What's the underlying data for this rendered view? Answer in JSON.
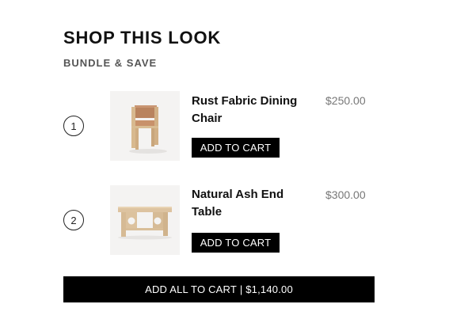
{
  "header": {
    "title": "SHOP THIS LOOK",
    "subtitle": "BUNDLE & SAVE"
  },
  "products": [
    {
      "number": "1",
      "name": "Rust Fabric Dining Chair",
      "price": "$250.00",
      "button_label": "ADD TO CART",
      "image_icon": "dining-chair-icon"
    },
    {
      "number": "2",
      "name": "Natural Ash End Table",
      "price": "$300.00",
      "button_label": "ADD TO CART",
      "image_icon": "end-table-icon"
    }
  ],
  "footer": {
    "add_all_label": "ADD ALL TO CART",
    "total": "$1,140.00"
  }
}
